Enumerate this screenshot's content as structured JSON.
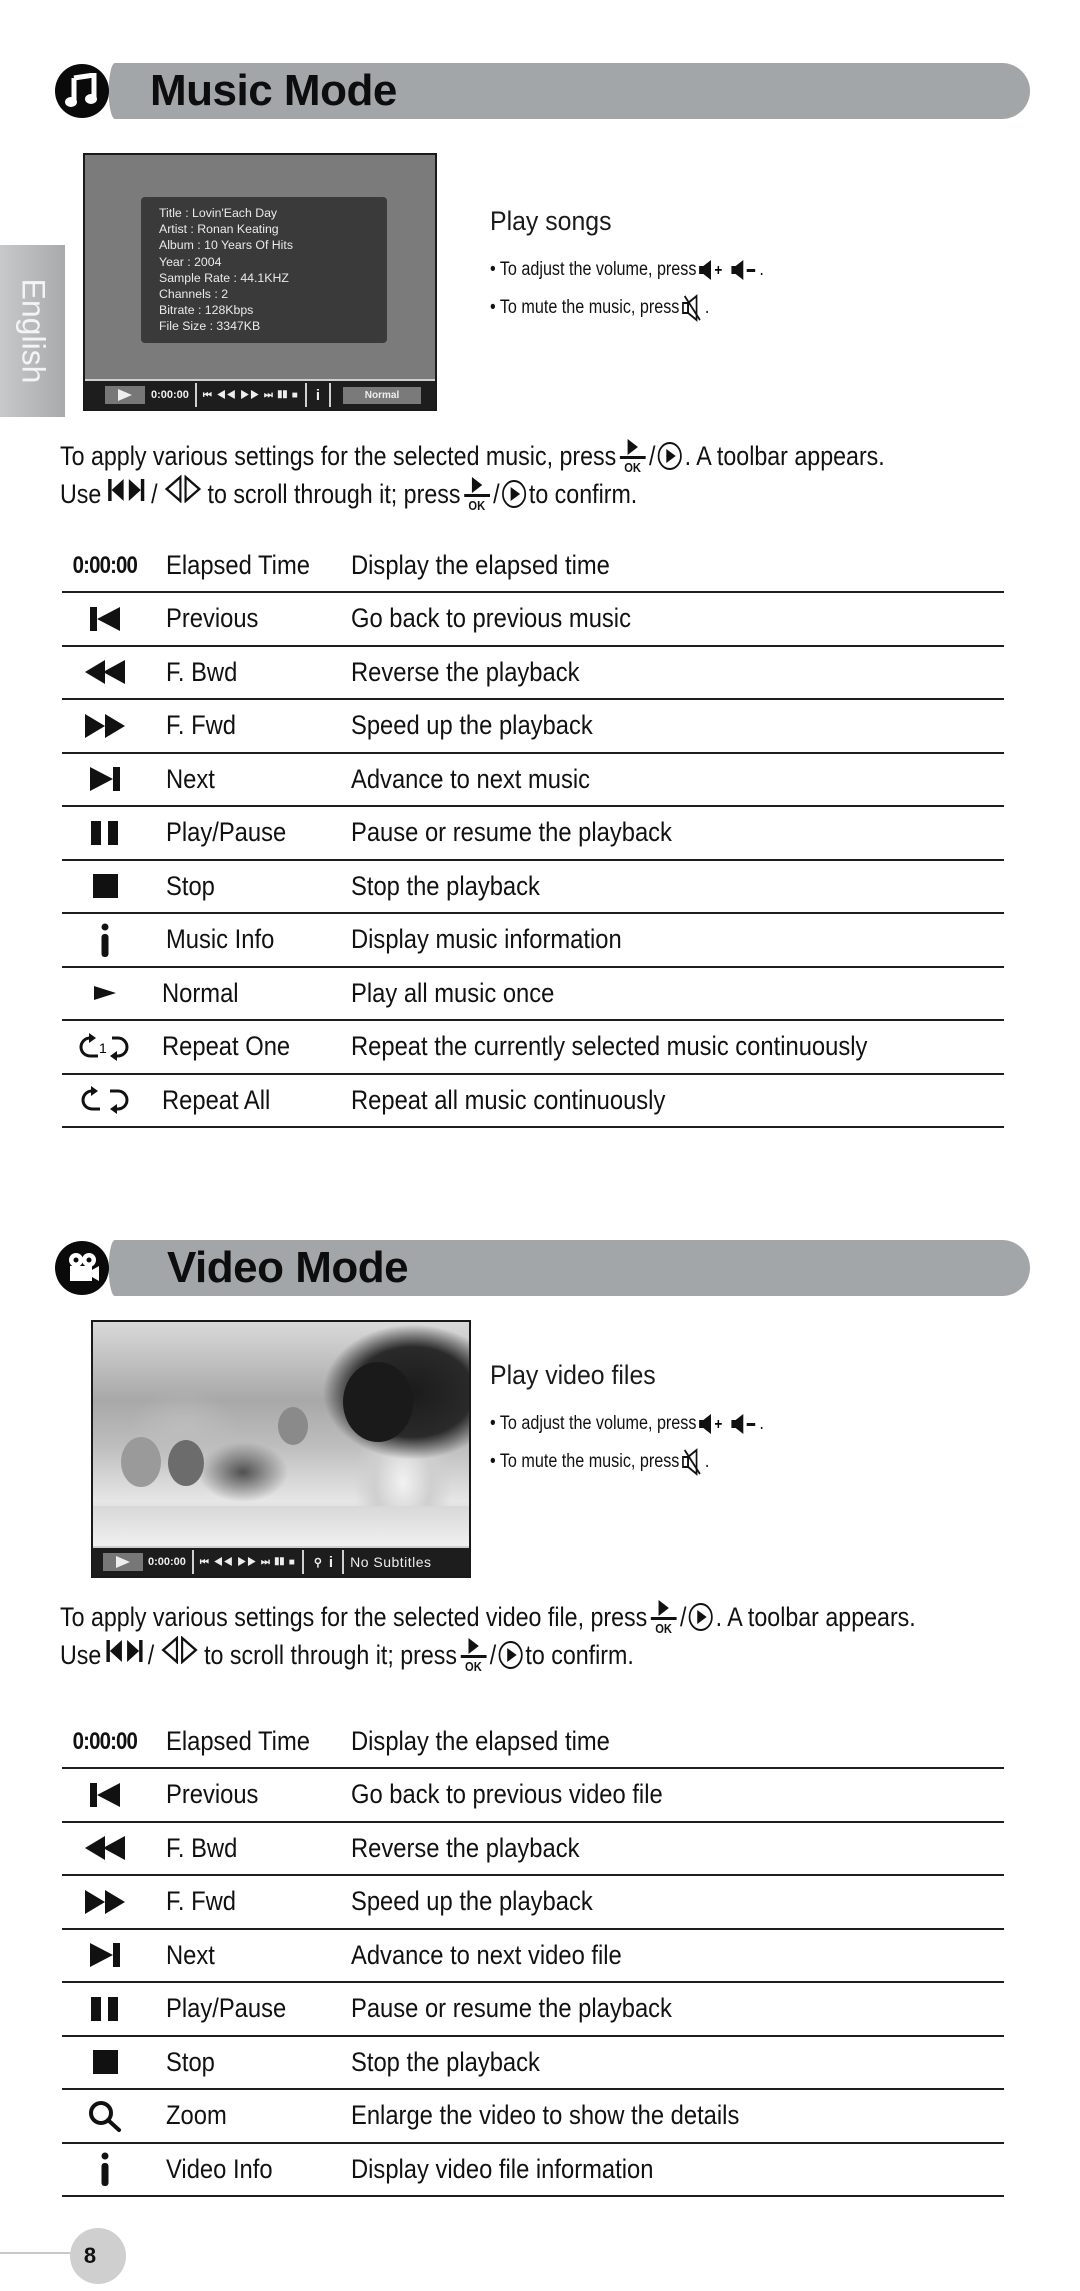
{
  "language_tab": "English",
  "music_section": {
    "title": "Music Mode",
    "icon": "music-note-icon",
    "screen": {
      "info_lines": [
        "Title : Lovin'Each Day",
        "Artist : Ronan Keating",
        "Album : 10 Years Of Hits",
        "Year : 2004",
        "Sample Rate : 44.1KHZ",
        "Channels : 2",
        "Bitrate : 128Kbps",
        "File Size : 3347KB"
      ],
      "time": "0:00:00",
      "controls": "⏮ ◀◀ ▶▶ ⏭ ❚❚ ■",
      "info_glyph": "i",
      "mode": "Normal"
    },
    "side_heading": "Play songs",
    "bullet_volume": "• To adjust the volume, press",
    "bullet_mute": "• To mute the music, press",
    "para_line1_a": "To apply various settings for the selected music, press",
    "para_line1_b": ". A toolbar appears.",
    "para_line2_a": "Use",
    "para_line2_b": "to scroll through it; press",
    "para_line2_c": "to confirm.",
    "ok_label": "OK",
    "rows": [
      {
        "icon": "elapsed-time-icon",
        "icon_text": "0:00:00",
        "name": "Elapsed Time",
        "desc": "Display the elapsed time"
      },
      {
        "icon": "previous-icon",
        "name": "Previous",
        "desc": "Go back to previous music"
      },
      {
        "icon": "fast-backward-icon",
        "name": "F. Bwd",
        "desc": "Reverse the playback"
      },
      {
        "icon": "fast-forward-icon",
        "name": "F. Fwd",
        "desc": "Speed up the playback"
      },
      {
        "icon": "next-icon",
        "name": "Next",
        "desc": "Advance to next music"
      },
      {
        "icon": "play-pause-icon",
        "name": "Play/Pause",
        "desc": "Pause or resume the playback"
      },
      {
        "icon": "stop-icon",
        "name": "Stop",
        "desc": "Stop the playback"
      },
      {
        "icon": "info-icon",
        "name": "Music Info",
        "desc": "Display music information"
      },
      {
        "icon": "normal-play-icon",
        "name": "Normal",
        "desc": "Play all music once"
      },
      {
        "icon": "repeat-one-icon",
        "name": "Repeat One",
        "desc": "Repeat the currently selected music continuously"
      },
      {
        "icon": "repeat-all-icon",
        "name": "Repeat All",
        "desc": "Repeat all music continuously"
      }
    ]
  },
  "video_section": {
    "title": "Video Mode",
    "icon": "movie-camera-icon",
    "screen": {
      "time": "0:00:00",
      "controls": "⏮ ◀◀ ▶▶ ⏭ ❚❚ ■",
      "info_glyph": "i",
      "subtitles": "No Subtitles"
    },
    "side_heading": "Play video files",
    "bullet_volume": "• To adjust the volume, press",
    "bullet_mute": "• To mute the music, press",
    "para_line1_a": "To apply various settings for the selected video file, press",
    "para_line1_b": ". A toolbar appears.",
    "para_line2_a": "Use",
    "para_line2_b": "to scroll through it; press",
    "para_line2_c": "to confirm.",
    "ok_label": "OK",
    "rows": [
      {
        "icon": "elapsed-time-icon",
        "icon_text": "0:00:00",
        "name": "Elapsed Time",
        "desc": "Display the elapsed time"
      },
      {
        "icon": "previous-icon",
        "name": "Previous",
        "desc": "Go back to previous video file"
      },
      {
        "icon": "fast-backward-icon",
        "name": "F. Bwd",
        "desc": "Reverse the playback"
      },
      {
        "icon": "fast-forward-icon",
        "name": "F. Fwd",
        "desc": "Speed up the playback"
      },
      {
        "icon": "next-icon",
        "name": "Next",
        "desc": "Advance to next video file"
      },
      {
        "icon": "play-pause-icon",
        "name": "Play/Pause",
        "desc": "Pause or resume the playback"
      },
      {
        "icon": "stop-icon",
        "name": "Stop",
        "desc": "Stop the playback"
      },
      {
        "icon": "zoom-icon",
        "name": "Zoom",
        "desc": "Enlarge the video to show the details"
      },
      {
        "icon": "info-icon",
        "name": "Video Info",
        "desc": "Display video file information"
      }
    ]
  },
  "page_number": "8"
}
